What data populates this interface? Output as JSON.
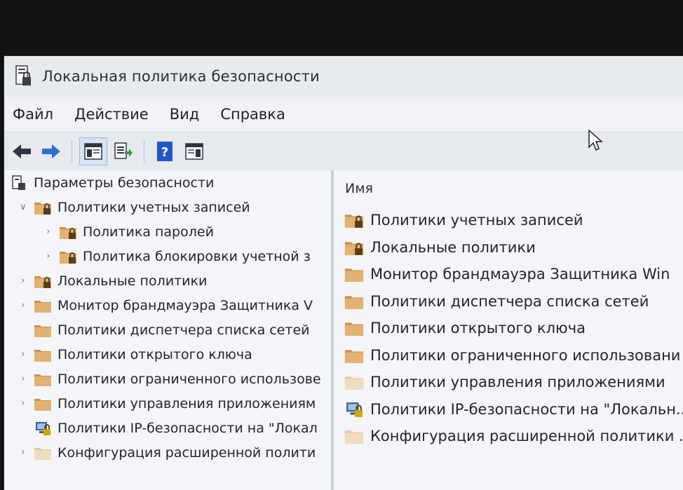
{
  "window": {
    "title": "Локальная политика безопасности"
  },
  "menu": [
    "Файл",
    "Действие",
    "Вид",
    "Справка"
  ],
  "toolbar": {
    "buttons": [
      "back-arrow-icon",
      "forward-arrow-icon",
      "console-tree-icon",
      "export-list-icon",
      "help-icon",
      "properties-pane-icon"
    ]
  },
  "tree": {
    "root": "Параметры безопасности",
    "account_policies": "Политики учетных записей",
    "password_policy": "Политика паролей",
    "lockout_policy": "Политика блокировки учетной з",
    "local_policies": "Локальные политики",
    "firewall_monitor": "Монитор брандмауэра Защитника V",
    "network_list": "Политики диспетчера списка сетей",
    "public_key": "Политики открытого ключа",
    "restricted_use": "Политики ограниченного использове",
    "app_control": "Политики управления приложениям",
    "ipsec": "Политики IP-безопасности на \"Локал",
    "advanced_audit": "Конфигурация расширенной полити"
  },
  "list": {
    "column_name": "Имя",
    "items": [
      "Политики учетных записей",
      "Локальные политики",
      "Монитор брандмауэра Защитника Win",
      "Политики диспетчера списка сетей",
      "Политики открытого ключа",
      "Политики ограниченного использовани",
      "Политики управления приложениями",
      "Политики IP-безопасности на \"Локальн...",
      "Конфигурация расширенной политики ..."
    ]
  },
  "colors": {
    "folder": "#d9a766",
    "folder_dark": "#b27a3a",
    "lock": "#6b4a1c",
    "selection": "#d6e3f3"
  }
}
